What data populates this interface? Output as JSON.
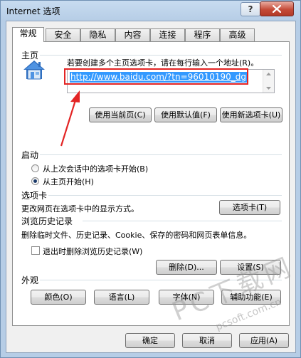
{
  "window": {
    "title": "Internet 选项",
    "help_label": "?"
  },
  "tabs": [
    {
      "label": "常规",
      "active": true
    },
    {
      "label": "安全"
    },
    {
      "label": "隐私"
    },
    {
      "label": "内容"
    },
    {
      "label": "连接"
    },
    {
      "label": "程序"
    },
    {
      "label": "高级"
    }
  ],
  "homepage": {
    "section_title": "主页",
    "instruction": "若要创建多个主页选项卡，请在每行输入一个地址(R)。",
    "url": "http://www.baidu.com/?tn=96010190_dg",
    "buttons": {
      "use_current": "使用当前页(C)",
      "use_default": "使用默认值(F)",
      "use_new_tab": "使用新选项卡(U)"
    }
  },
  "startup": {
    "section_title": "启动",
    "option_last_session": "从上次会话中的选项卡开始(B)",
    "option_home_page": "从主页开始(H)",
    "selected": "home_page"
  },
  "tabs_section": {
    "section_title": "选项卡",
    "description": "更改网页在选项卡中的显示方式。",
    "button": "选项卡(T)"
  },
  "history": {
    "section_title": "浏览历史记录",
    "description": "删除临时文件、历史记录、Cookie、保存的密码和网页表单信息。",
    "checkbox_label": "退出时删除浏览历史记录(W)",
    "checked": false,
    "delete_button": "删除(D)...",
    "settings_button": "设置(S)"
  },
  "appearance": {
    "section_title": "外观",
    "colors_button": "颜色(O)",
    "languages_button": "语言(L)",
    "fonts_button": "字体(N)",
    "accessibility_button": "辅助功能(E)"
  },
  "footer": {
    "ok": "确定",
    "cancel": "取消",
    "apply": "应用(A)"
  },
  "watermark": {
    "brand": "PC下载网",
    "site": "pcsoft.com.cn"
  },
  "colors": {
    "selection": "#3399ff",
    "highlight_box": "#e32424",
    "close_button": "#c54b38"
  }
}
